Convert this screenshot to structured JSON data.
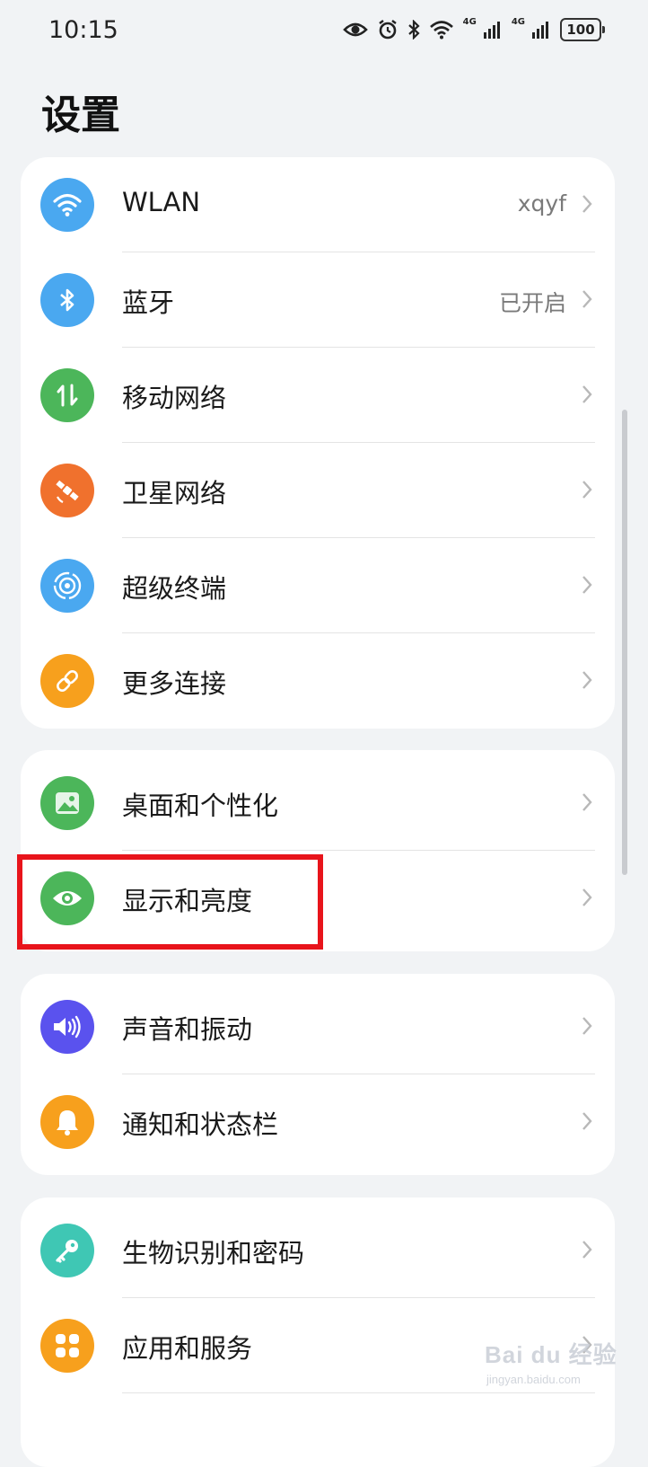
{
  "status_bar": {
    "time": "10:15",
    "network_1": "4G",
    "network_2": "4G",
    "battery": "100",
    "icons": [
      "eye-comfort-icon",
      "alarm-icon",
      "bluetooth-icon",
      "wifi-icon",
      "signal-icon",
      "signal-icon",
      "battery-icon"
    ]
  },
  "header": {
    "title": "设置"
  },
  "groups": [
    {
      "items": [
        {
          "label": "WLAN",
          "value": "xqyf",
          "icon": "wifi-icon",
          "color": "#4aa8f0"
        },
        {
          "label": "蓝牙",
          "value": "已开启",
          "icon": "bluetooth-icon",
          "color": "#4aa8f0"
        },
        {
          "label": "移动网络",
          "value": "",
          "icon": "mobile-data-icon",
          "color": "#4cb65a"
        },
        {
          "label": "卫星网络",
          "value": "",
          "icon": "satellite-icon",
          "color": "#f0712d"
        },
        {
          "label": "超级终端",
          "value": "",
          "icon": "super-device-icon",
          "color": "#4aa8f0"
        },
        {
          "label": "更多连接",
          "value": "",
          "icon": "link-icon",
          "color": "#f7a01d"
        }
      ]
    },
    {
      "items": [
        {
          "label": "桌面和个性化",
          "value": "",
          "icon": "image-icon",
          "color": "#4cb65a"
        },
        {
          "label": "显示和亮度",
          "value": "",
          "icon": "eye-icon",
          "color": "#4cb65a",
          "highlighted": true
        }
      ]
    },
    {
      "items": [
        {
          "label": "声音和振动",
          "value": "",
          "icon": "speaker-icon",
          "color": "#5a52ee"
        },
        {
          "label": "通知和状态栏",
          "value": "",
          "icon": "bell-icon",
          "color": "#f7a01d"
        }
      ]
    },
    {
      "items": [
        {
          "label": "生物识别和密码",
          "value": "",
          "icon": "key-icon",
          "color": "#3fc7b4"
        },
        {
          "label": "应用和服务",
          "value": "",
          "icon": "apps-icon",
          "color": "#f7a01d"
        }
      ]
    }
  ],
  "watermark": {
    "text": "Bai du 经验",
    "sub": "jingyan.baidu.com"
  }
}
